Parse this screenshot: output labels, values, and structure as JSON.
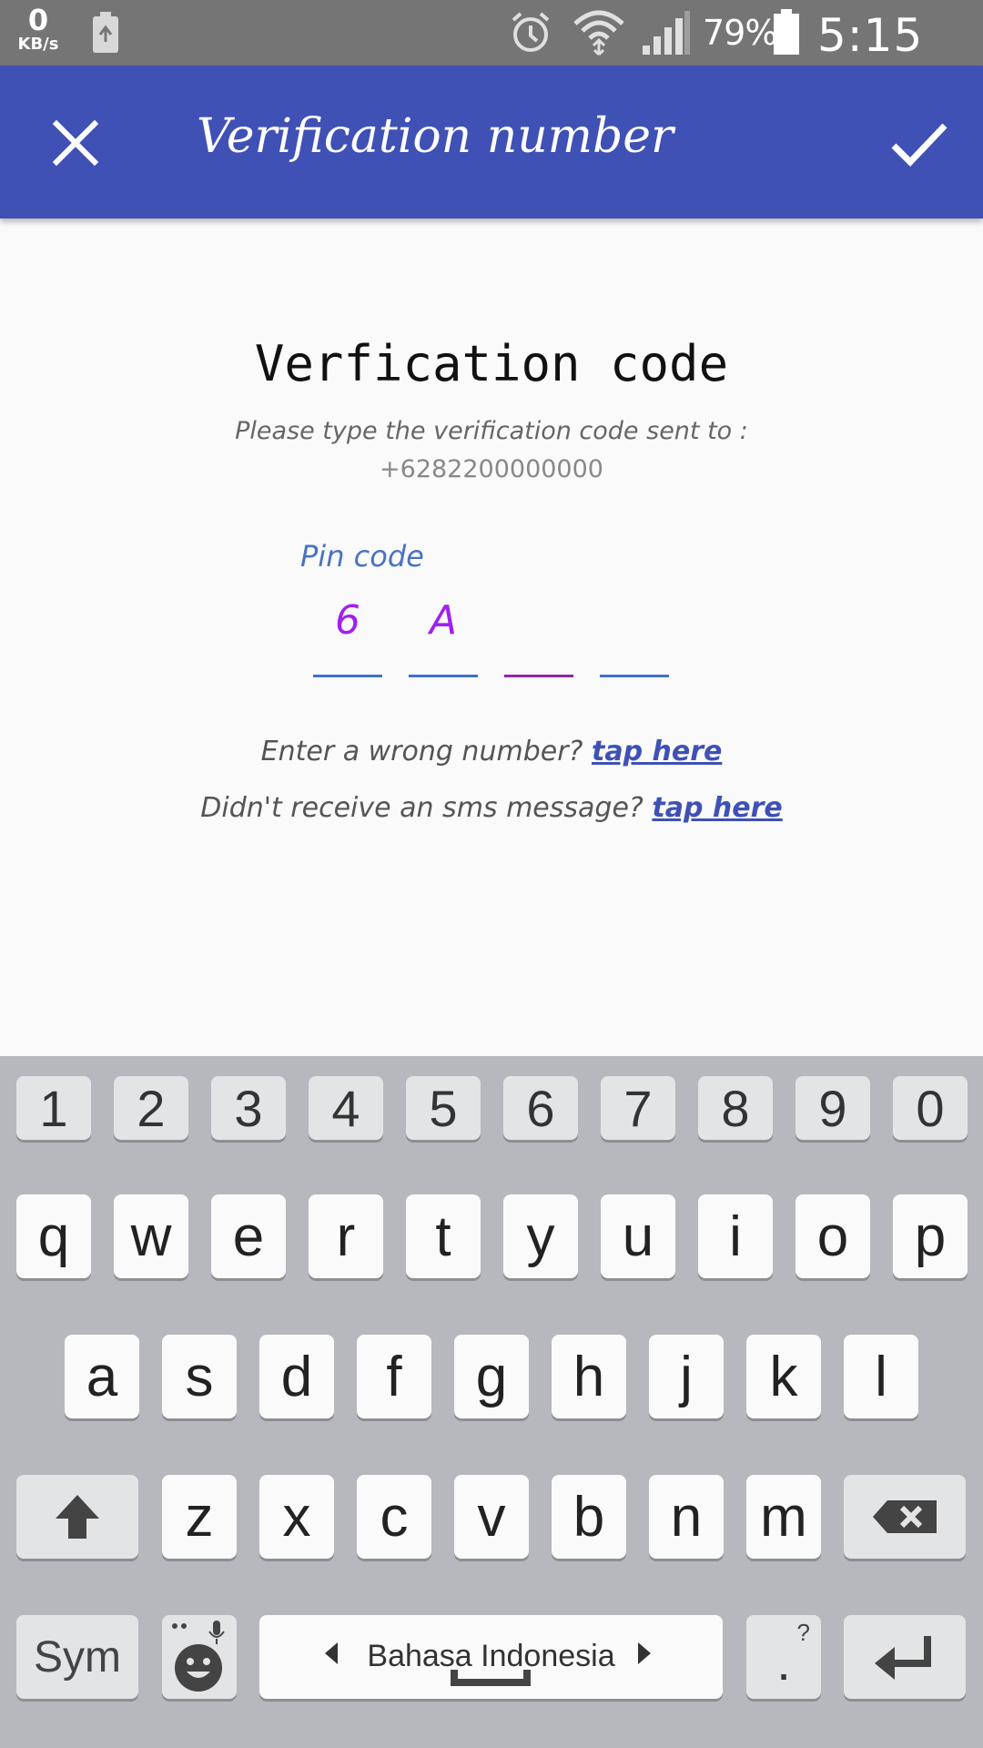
{
  "status_bar": {
    "kbs_value": "0",
    "kbs_unit": "KB/s",
    "battery_pct": "79%",
    "time": "5:15 AM"
  },
  "app_bar": {
    "title": "Verification number",
    "bg_color": "#3f51b5"
  },
  "content": {
    "heading": "Verfication code",
    "instruction": "Please type the verification code sent to :",
    "phone": "+6282200000000",
    "pin_label": "Pin code",
    "pin_digits": [
      "6",
      "A",
      "",
      ""
    ],
    "wrong_number_text": "Enter a wrong number?",
    "wrong_number_link": "tap here",
    "no_sms_text": "Didn't receive an sms message?",
    "no_sms_link": "tap here"
  },
  "keyboard": {
    "number_row": [
      "1",
      "2",
      "3",
      "4",
      "5",
      "6",
      "7",
      "8",
      "9",
      "0"
    ],
    "row1": [
      "q",
      "w",
      "e",
      "r",
      "t",
      "y",
      "u",
      "i",
      "o",
      "p"
    ],
    "row2": [
      "a",
      "s",
      "d",
      "f",
      "g",
      "h",
      "j",
      "k",
      "l"
    ],
    "row3": [
      "z",
      "x",
      "c",
      "v",
      "b",
      "n",
      "m"
    ],
    "sym_label": "Sym",
    "language": "Bahasa Indonesia",
    "period": ".",
    "punct_hint": "?"
  }
}
